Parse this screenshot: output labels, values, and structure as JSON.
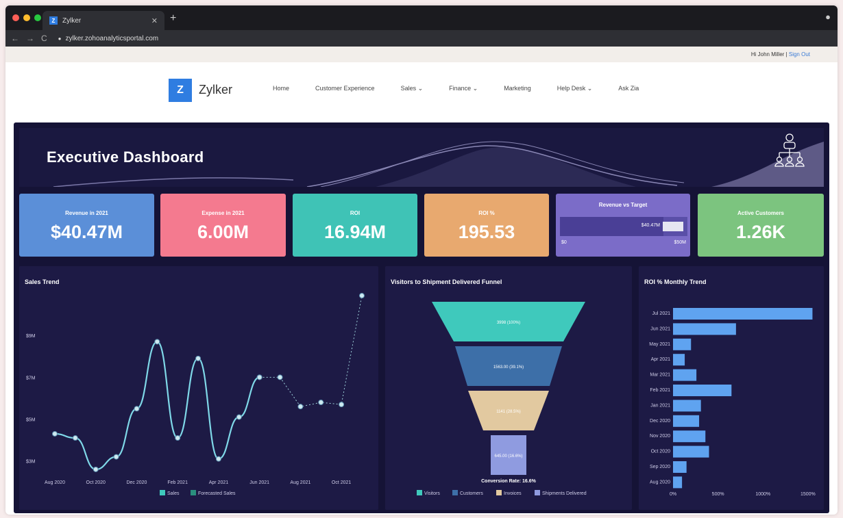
{
  "browser": {
    "tab_title": "Zylker",
    "url": "zylker.zohoanalyticsportal.com"
  },
  "topbar": {
    "greeting": "Hi John Miller",
    "separator": "|",
    "signout": "Sign Out"
  },
  "nav": {
    "logo_letter": "Z",
    "logo_name": "Zylker",
    "items": [
      "Home",
      "Customer Experience",
      "Sales ⌄",
      "Finance ⌄",
      "Marketing",
      "Help Desk ⌄",
      "Ask Zia"
    ]
  },
  "dashboard": {
    "title": "Executive Dashboard",
    "kpis": [
      {
        "label": "Revenue in 2021",
        "value": "$40.47M",
        "color": "#5b8fd8"
      },
      {
        "label": "Expense in 2021",
        "value": "6.00M",
        "color": "#f47a8f"
      },
      {
        "label": "ROI",
        "value": "16.94M",
        "color": "#3fc3b6"
      },
      {
        "label": "ROI %",
        "value": "195.53",
        "color": "#e8a96f"
      },
      {
        "label": "Revenue vs Target",
        "bar_value": "$40.47M",
        "min": "$0",
        "max": "$50M",
        "fill": 0.81,
        "color": "#7b6cc8"
      },
      {
        "label": "Active Customers",
        "value": "1.26K",
        "color": "#7cc47f"
      }
    ]
  },
  "sales_trend": {
    "title": "Sales Trend",
    "legend": [
      "Sales",
      "Forecasted Sales"
    ]
  },
  "funnel": {
    "title": "Visitors to Shipment Delivered Funnel",
    "stages": [
      {
        "label": "3998 (100%)",
        "color": "#3fc9bc"
      },
      {
        "label": "1563.00 (39.1%)",
        "color": "#3d6fa8"
      },
      {
        "label": "1141 (28.5%)",
        "color": "#e2c9a0"
      },
      {
        "label": "645.00 (16.6%)",
        "color": "#8f9be0"
      }
    ],
    "conversion": "Conversion Rate: 16.6%",
    "legend": [
      "Visitors",
      "Customers",
      "Invoices",
      "Shipments Delivered"
    ]
  },
  "roi_trend": {
    "title": "ROI % Monthly Trend"
  },
  "chart_data": [
    {
      "type": "line",
      "title": "Sales Trend",
      "x": [
        "Aug 2020",
        "Sep 2020",
        "Oct 2020",
        "Nov 2020",
        "Dec 2020",
        "Jan 2021",
        "Feb 2021",
        "Mar 2021",
        "Apr 2021",
        "May 2021",
        "Jun 2021",
        "Jul 2021",
        "Aug 2021",
        "Sep 2021",
        "Oct 2021",
        "Nov 2021"
      ],
      "x_tick_labels": [
        "Aug 2020",
        "Oct 2020",
        "Dec 2020",
        "Feb 2021",
        "Apr 2021",
        "Jun 2021",
        "Aug 2021",
        "Oct 2021"
      ],
      "y_tick_labels": [
        "$3M",
        "$5M",
        "$7M",
        "$9M"
      ],
      "ylim": [
        2.5,
        11
      ],
      "series": [
        {
          "name": "Sales",
          "color": "#7fd8e8",
          "x": [
            "Aug 2020",
            "Sep 2020",
            "Oct 2020",
            "Nov 2020",
            "Dec 2020",
            "Jan 2021",
            "Feb 2021",
            "Mar 2021",
            "Apr 2021",
            "May 2021",
            "Jun 2021"
          ],
          "values": [
            4.3,
            4.1,
            2.6,
            3.2,
            5.5,
            8.7,
            4.1,
            7.9,
            3.1,
            5.1,
            7.0
          ]
        },
        {
          "name": "Forecasted Sales",
          "color": "#9ed2db",
          "x": [
            "Jun 2021",
            "Jul 2021",
            "Aug 2021",
            "Sep 2021",
            "Oct 2021",
            "Nov 2021"
          ],
          "values": [
            7.0,
            7.0,
            5.6,
            5.8,
            5.7,
            10.9
          ]
        }
      ]
    },
    {
      "type": "funnel",
      "title": "Visitors to Shipment Delivered Funnel",
      "categories": [
        "Visitors",
        "Customers",
        "Invoices",
        "Shipments Delivered"
      ],
      "values": [
        3998,
        1563,
        1141,
        645
      ]
    },
    {
      "type": "bar",
      "orientation": "horizontal",
      "title": "ROI % Monthly Trend",
      "categories": [
        "Jul 2021",
        "Jun 2021",
        "May 2021",
        "Apr 2021",
        "Mar 2021",
        "Feb 2021",
        "Jan 2021",
        "Dec 2020",
        "Nov 2020",
        "Oct 2020",
        "Sep 2020",
        "Aug 2020"
      ],
      "values": [
        1550,
        700,
        200,
        130,
        260,
        650,
        310,
        290,
        360,
        400,
        150,
        100
      ],
      "x_tick_labels": [
        "0%",
        "500%",
        "1000%",
        "1500%"
      ],
      "xlim": [
        0,
        1600
      ],
      "color": "#5fa3f0"
    }
  ]
}
